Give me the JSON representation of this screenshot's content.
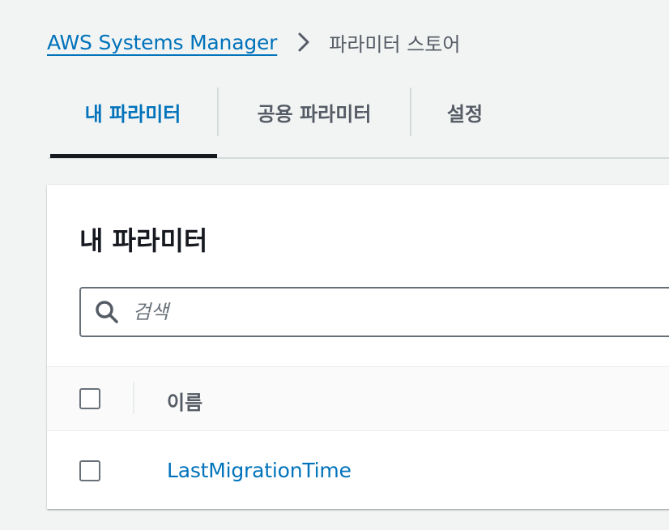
{
  "breadcrumb": {
    "service": "AWS Systems Manager",
    "current": "파라미터 스토어"
  },
  "tabs": [
    {
      "label": "내 파라미터",
      "active": true
    },
    {
      "label": "공용 파라미터",
      "active": false
    },
    {
      "label": "설정",
      "active": false
    }
  ],
  "panel": {
    "title": "내 파라미터",
    "search_placeholder": "검색",
    "columns": [
      "이름"
    ],
    "rows": [
      {
        "name": "LastMigrationTime",
        "selected": false
      }
    ]
  },
  "colors": {
    "link": "#0073bb",
    "active_tab_bar": "#16191f",
    "background": "#f2f3f3"
  }
}
